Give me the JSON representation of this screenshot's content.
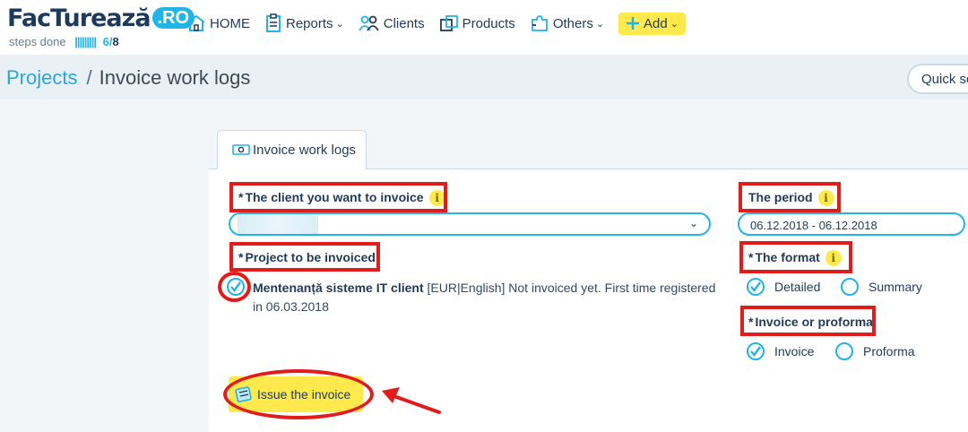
{
  "brand": {
    "name": "FacTurează",
    "tld": ".RO",
    "steps_label": "steps done",
    "steps_bars": "|||||||||",
    "steps_done": "6",
    "steps_total": "8"
  },
  "nav": {
    "home": "HOME",
    "reports": "Reports",
    "clients": "Clients",
    "products": "Products",
    "others": "Others",
    "add": "Add"
  },
  "breadcrumb": {
    "parent": "Projects",
    "separator": "/",
    "current": "Invoice work logs"
  },
  "quick_search": "Quick se",
  "tab": {
    "label": "Invoice work logs"
  },
  "form": {
    "client_label": "The client you want to invoice",
    "required_mark": "*",
    "info_glyph": "i",
    "project_label": "Project to be invoiced",
    "project": {
      "name": "Mentenanță sisteme IT client",
      "details": " [EUR|English] Not invoiced yet. First time registered in 06.03.2018",
      "checked": true
    },
    "period_label": "The period",
    "period_value": "06.12.2018 - 06.12.2018",
    "format_label": "The format",
    "format_options": [
      "Detailed",
      "Summary"
    ],
    "format_selected": "Detailed",
    "type_label": "Invoice or proforma",
    "type_options": [
      "Invoice",
      "Proforma"
    ],
    "type_selected": "Invoice",
    "submit_label": "Issue the invoice"
  },
  "colors": {
    "accent": "#22b4e6",
    "highlight": "#ffe94d",
    "annotation": "#e21b1b",
    "text": "#1f3b57"
  }
}
